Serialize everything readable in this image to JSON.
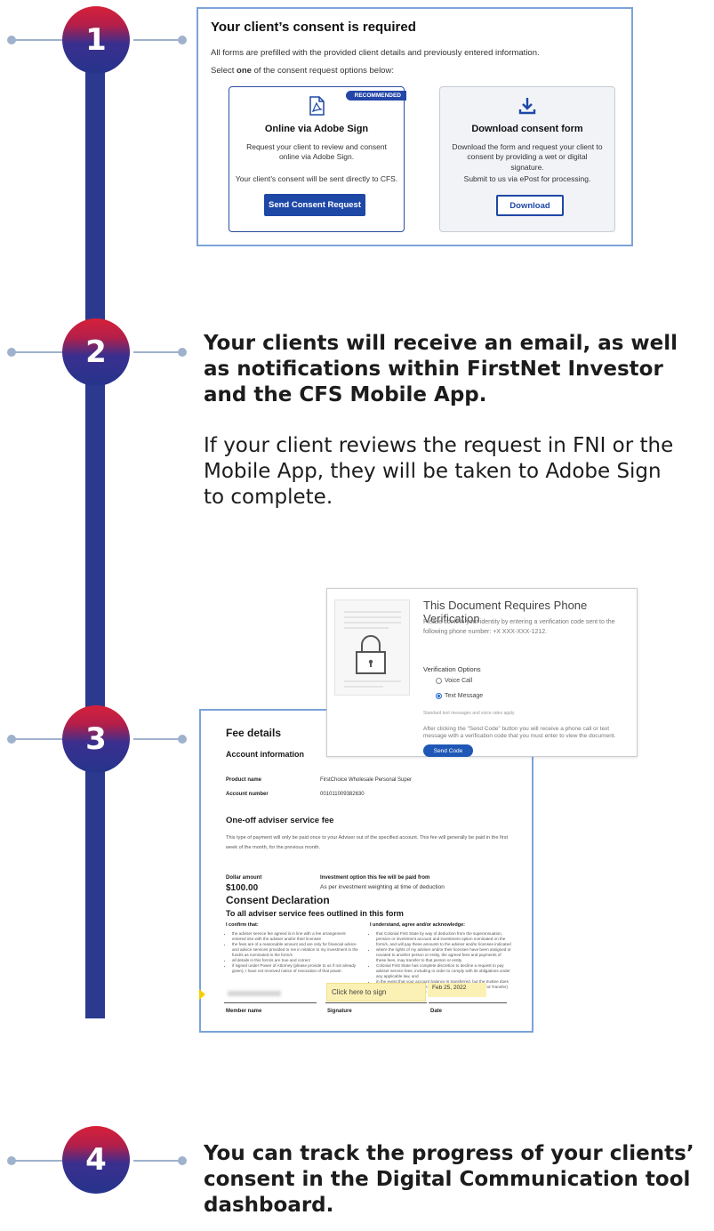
{
  "steps": [
    {
      "number": "1"
    },
    {
      "number": "2",
      "heading": "Your clients will receive an email, as well as notifications within FirstNet Investor and the CFS Mobile App.",
      "body": "If your client reviews the request in FNI or the Mobile App, they will be taken to Adobe Sign to complete."
    },
    {
      "number": "3"
    },
    {
      "number": "4",
      "heading": "You can track the progress of your clients’ consent in the Digital Communication tool dashboard."
    }
  ],
  "consent": {
    "title": "Your client’s consent is required",
    "intro": "All forms are prefilled with the provided client details and previously entered information.",
    "select_prefix": "Select ",
    "select_bold": "one",
    "select_suffix": " of the consent request options below:",
    "online": {
      "badge": "RECOMMENDED",
      "title": "Online via Adobe Sign",
      "desc": "Request your client to review and consent online via Adobe Sign.",
      "desc2": "Your client’s consent will be sent directly to CFS.",
      "button": "Send Consent Request",
      "icon": "pdf-icon"
    },
    "download": {
      "title": "Download consent form",
      "desc": "Download the form and request your client to consent by providing a wet or digital signature.",
      "desc2": "Submit to us via ePost for processing.",
      "button": "Download",
      "icon": "download-icon"
    }
  },
  "verify": {
    "title": "This Document Requires Phone Verification",
    "text": "Please confirm your identity by entering a verification code sent to the following phone number: +X XXX-XXX-1212.",
    "options_label": "Verification Options",
    "option_voice": "Voice Call",
    "option_text": "Text Message",
    "selected": "Text Message",
    "note": "Standard text messages and voice rates apply",
    "after": "After clicking the \"Send Code\" button you will receive a phone call or text message with a verification code that you must enter to view the document.",
    "button": "Send Code"
  },
  "fee": {
    "title": "Fee details",
    "account_heading": "Account information",
    "product_label": "Product name",
    "product_value": "FirstChoice Wholesale Personal Super",
    "account_label": "Account number",
    "account_value": "001011009382630",
    "oneoff_heading": "One-off adviser service fee",
    "oneoff_text": "This type of payment will only be paid once to your Adviser out of the specified account. This fee will generally be paid in the first week of the month, for the previous month.",
    "dollar_label": "Dollar amount",
    "dollar_value": "$100.00",
    "investment_label": "Investment option this fee will be paid from",
    "investment_value": "As per investment weighting at time of deduction",
    "declaration_heading": "Consent Declaration",
    "declaration_sub": "To all adviser service fees outlined in this form",
    "confirm_label": "I confirm that:",
    "confirm_items": [
      "the adviser service fee agreed is in line with a fee arrangement entered into with the adviser and/or their licensee",
      "the fees are of a reasonable amount and are only for financial advice and advice services provided to me in relation to my investment in the fund/s as nominated in the form/s",
      "all details in this form/s are true and correct",
      "if signed under Power of Attorney (please provide to us if not already given), I have not received notice of revocation of that power."
    ],
    "ack_label": "I understand, agree and/or acknowledge:",
    "ack_items": [
      "that Colonial First State by way of deduction from the superannuation, pension or investment account and investment option nominated on the form/s, and will pay these amounts to the adviser and/or licensee indicated",
      "where the rights of my adviser and/or their licensee have been assigned or novated to another person or entity, the agreed fees and payments of these fees, may transfer to that person or entity",
      "Colonial First State has complete discretion to decline a request to pay adviser service fees, including in order to comply with its obligations under any applicable law, and",
      "in the event that your account balance is transferred, but the trustee does not change (for example a Successor Fund Transfer/Intra-Fund Transfer) this adviser service fee may transfer to the new account."
    ],
    "sign_prompt": "Click here to sign",
    "date_value": "Feb 25, 2022",
    "member_label": "Member name",
    "signature_label": "Signature",
    "date_label": "Date"
  },
  "colors": {
    "spine": "#2b3a8f",
    "accent_blue": "#1e48a6",
    "panel_border": "#7ba3d8",
    "sign_highlight": "#fbf1b5"
  }
}
